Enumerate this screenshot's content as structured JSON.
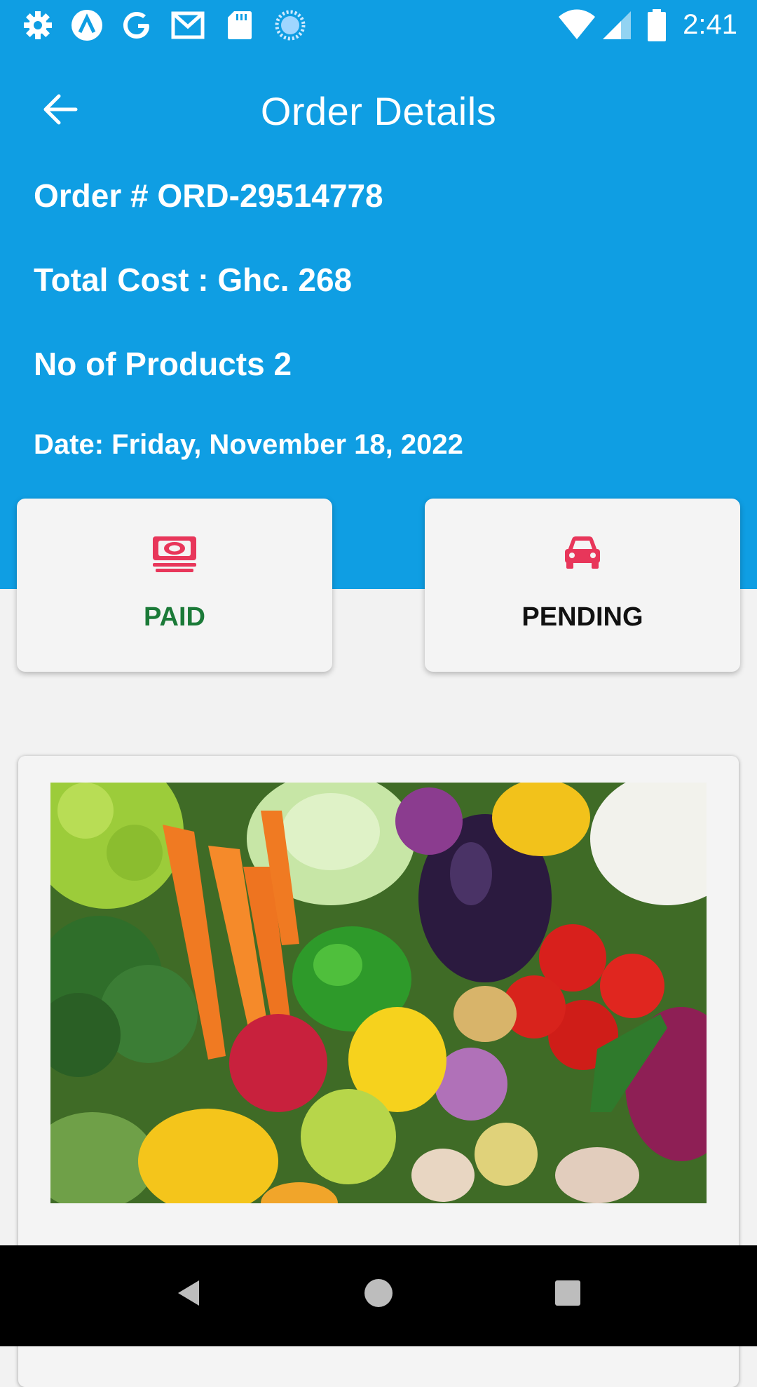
{
  "status_bar": {
    "time": "2:41",
    "left_icons": [
      "gear-icon",
      "arrow-up-circle-icon",
      "google-icon",
      "gmail-icon",
      "sd-card-icon",
      "loading-icon"
    ],
    "right_icons": [
      "wifi-icon",
      "signal-icon",
      "battery-icon"
    ]
  },
  "app_bar": {
    "title": "Order Details",
    "back_icon": "arrow-left-icon"
  },
  "order": {
    "number": "Order # ORD-29514778",
    "total_cost": "Total Cost : Ghc. 268",
    "products": "No of Products 2",
    "date": "Date: Friday, November 18, 2022"
  },
  "status_cards": [
    {
      "label": "PAID",
      "icon": "money-icon",
      "label_color": "#1b7a38"
    },
    {
      "label": "PENDING",
      "icon": "car-icon",
      "label_color": "#111111"
    }
  ],
  "colors": {
    "header": "#0f9ee3",
    "icon_accent": "#e8365a",
    "background": "#f2f2f2"
  },
  "product": {
    "image": "vegetables-photo"
  },
  "nav_bar": {
    "icons": [
      "back-triangle-icon",
      "home-circle-icon",
      "recents-square-icon"
    ]
  }
}
